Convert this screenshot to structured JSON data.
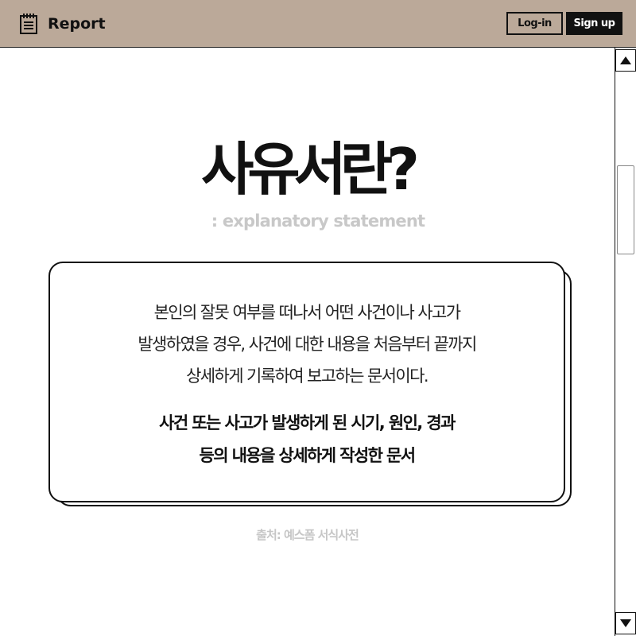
{
  "header": {
    "brand_icon": "notepad-icon",
    "title": "Report",
    "login_label": "Log-in",
    "signup_label": "Sign up"
  },
  "main": {
    "title": "사유서란?",
    "subtitle": ": explanatory statement",
    "description_lines": [
      "본인의 잘못 여부를 떠나서 어떤 사건이나 사고가",
      "발생하였을 경우, 사건에 대한 내용을 처음부터 끝까지",
      "상세하게 기록하여 보고하는 문서이다."
    ],
    "emphasis_lines": [
      "사건 또는 사고가 발생하게 된 시기, 원인, 경과",
      "등의 내용을 상세하게 작성한 문서"
    ],
    "source": "출처: 예스폼 서식사전"
  },
  "colors": {
    "header_bg": "#bba999",
    "text": "#111111",
    "muted": "#c8c8c8"
  }
}
